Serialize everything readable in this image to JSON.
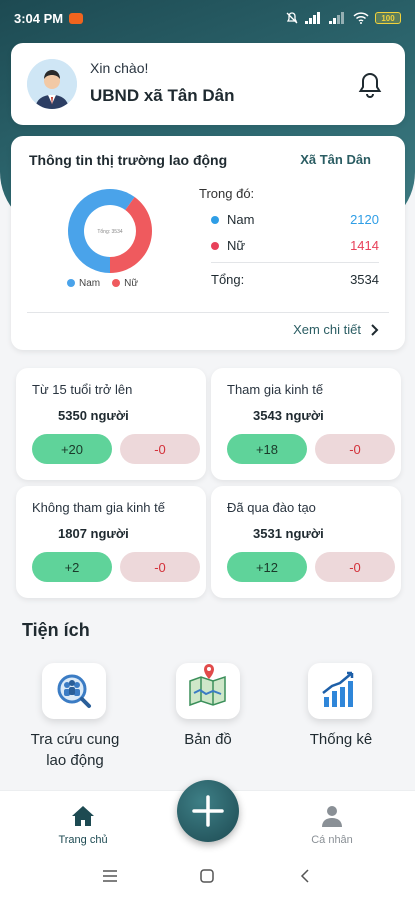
{
  "status": {
    "time": "3:04 PM",
    "battery": "100"
  },
  "greeting": {
    "hello": "Xin chào!",
    "name": "UBND xã Tân Dân"
  },
  "market": {
    "title": "Thông tin thị trường lao động",
    "area": "Xã Tân Dân",
    "breakdown_title": "Trong đó:",
    "rows": [
      {
        "label": "Nam",
        "value": "2120",
        "color": "#2f9ee6"
      },
      {
        "label": "Nữ",
        "value": "1414",
        "color": "#e8415a"
      }
    ],
    "total_label": "Tổng:",
    "total_value": "3534",
    "detail_link": "Xem chi tiết",
    "legend": [
      {
        "label": "Nam",
        "color": "#4aa3ea"
      },
      {
        "label": "Nữ",
        "color": "#ef5a5e"
      }
    ],
    "donut_center_text": "Tổng: 3534"
  },
  "chart_data": {
    "type": "pie",
    "categories": [
      "Nam",
      "Nữ"
    ],
    "values": [
      2120,
      1414
    ],
    "colors": [
      "#4aa3ea",
      "#ef5a5e"
    ],
    "title": "",
    "legend_position": "bottom"
  },
  "stats": [
    {
      "label": "Từ 15 tuổi trở lên",
      "value": "5350 người",
      "up": "+20",
      "down": "-0"
    },
    {
      "label": "Tham gia kinh tế",
      "value": "3543 người",
      "up": "+18",
      "down": "-0"
    },
    {
      "label": "Không tham gia kinh tế",
      "value": "1807 người",
      "up": "+2",
      "down": "-0"
    },
    {
      "label": "Đã qua đào tạo",
      "value": "3531 người",
      "up": "+12",
      "down": "-0"
    }
  ],
  "utilities": {
    "heading": "Tiện ích",
    "items": [
      {
        "label_line1": "Tra cứu cung",
        "label_line2": "lao động",
        "icon": "search-people-icon"
      },
      {
        "label_line1": "Bản đồ",
        "label_line2": "",
        "icon": "map-icon"
      },
      {
        "label_line1": "Thống kê",
        "label_line2": "",
        "icon": "bar-chart-icon"
      }
    ]
  },
  "nav": {
    "home": "Trang chủ",
    "profile": "Cá nhân"
  },
  "colors": {
    "primary": "#1d4a52",
    "accent": "#2b5d63",
    "up": "#5fd39a",
    "down_bg": "#edd8da",
    "down_text": "#d3323b"
  }
}
